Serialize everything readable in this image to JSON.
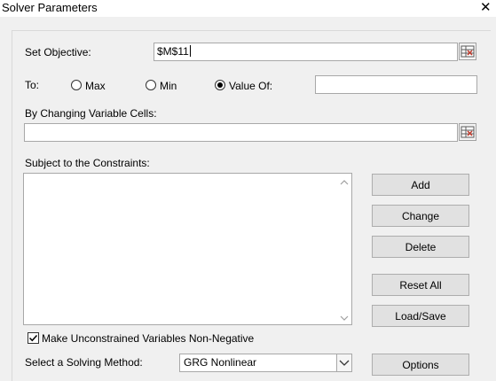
{
  "window": {
    "title": "Solver Parameters",
    "close_glyph": "✕"
  },
  "objective": {
    "label": "Set Objective:",
    "value": "$M$11"
  },
  "to": {
    "label": "To:",
    "options": [
      {
        "label": "Max",
        "selected": false
      },
      {
        "label": "Min",
        "selected": false
      },
      {
        "label": "Value Of:",
        "selected": true
      }
    ],
    "value_of": ""
  },
  "changing_cells": {
    "label": "By Changing Variable Cells:",
    "value": ""
  },
  "constraints": {
    "label": "Subject to the Constraints:",
    "items": []
  },
  "buttons": {
    "add": "Add",
    "change": "Change",
    "delete": "Delete",
    "reset_all": "Reset All",
    "load_save": "Load/Save",
    "options": "Options"
  },
  "non_negative": {
    "label": "Make Unconstrained Variables Non-Negative",
    "checked": true
  },
  "method": {
    "label": "Select a Solving Method:",
    "value": "GRG Nonlinear"
  },
  "icons": {
    "close": "close-icon",
    "ref": "range-selector-icon",
    "scroll_up": "scroll-up-icon",
    "scroll_down": "scroll-down-icon",
    "dropdown": "chevron-down-icon",
    "check": "checkmark-icon"
  }
}
